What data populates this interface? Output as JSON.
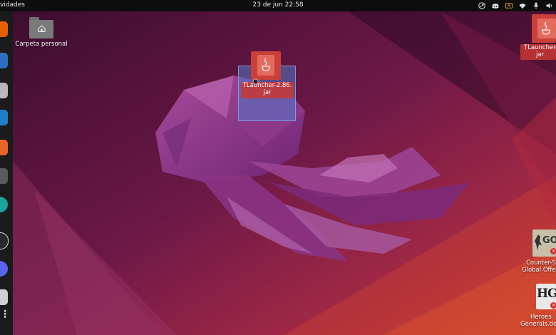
{
  "topbar": {
    "activities": "vidades",
    "clock": "23 de jun  22:58",
    "tray_icons": [
      "steam-icon",
      "discord-icon",
      "screen-share-icon",
      "wifi-icon",
      "mic-icon",
      "speaker-icon"
    ]
  },
  "dock": {
    "apps": [
      {
        "name": "firefox-icon",
        "color": "#e66000"
      },
      {
        "name": "thunderbird-icon",
        "color": "#2f6ec1"
      },
      {
        "name": "files-icon",
        "color": "#b8b8b8"
      },
      {
        "name": "writer-icon",
        "color": "#1f7fc6"
      },
      {
        "name": "software-icon",
        "color": "#e9652a"
      },
      {
        "name": "app-icon",
        "color": "#5a5a5a"
      },
      {
        "name": "cheese-icon",
        "color": "#1aa39a"
      },
      {
        "name": "obs-icon",
        "color": "#2a2a2a"
      },
      {
        "name": "discord-dock-icon",
        "color": "#5865f2"
      },
      {
        "name": "disk-icon",
        "color": "#d0d0d0"
      }
    ],
    "show_apps_label": "⋮"
  },
  "desktop": {
    "home_folder": "Carpeta personal",
    "jar_dragged_line1": "TLauncher-2.86.",
    "jar_dragged_line2": "jar",
    "jar_right_line1": "TLauncher-",
    "jar_right_line2": "jar",
    "csgo_icon_text": "GO",
    "csgo_line1": "Counter-St",
    "csgo_line2": "Global Offe",
    "heroes_icon_text": "HG",
    "heroes_line1": "Heroes",
    "heroes_line2": "Generals.de"
  },
  "colors": {
    "wall_dark": "#4a1238",
    "wall_mid": "#7a1f4e",
    "wall_orange": "#c0392b",
    "jelly": "#9c3c8c"
  }
}
